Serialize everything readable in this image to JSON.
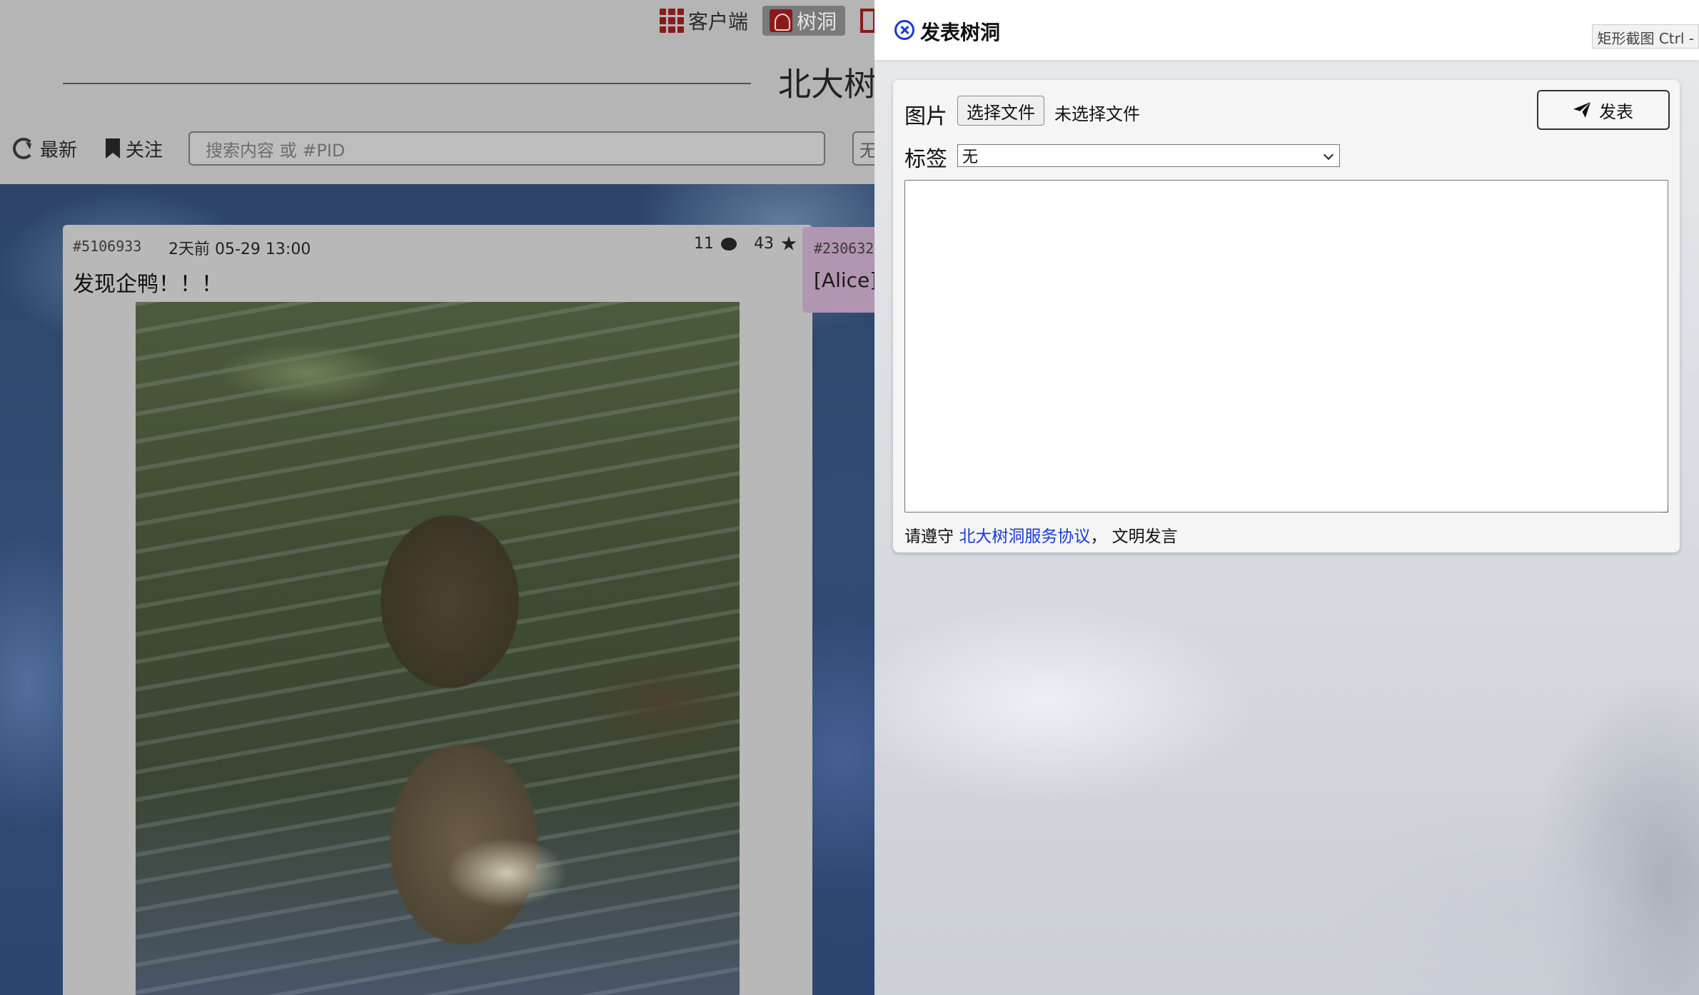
{
  "nav": {
    "client_label": "客户端",
    "treehole_label": "树洞",
    "site_title": "北大树洞"
  },
  "toolbar": {
    "refresh_label": "最新",
    "attention_label": "关注",
    "search_placeholder": "搜索内容 或 #PID",
    "search_mode_label": "无"
  },
  "posts": [
    {
      "pid": "#5106933",
      "time": "2天前  05-29 13:00",
      "reply_count": "11",
      "like_count": "43",
      "text": "发现企鸭！！！"
    },
    {
      "pid": "#230632",
      "text": "[Alice]"
    }
  ],
  "sidebar": {
    "title": "发表树洞",
    "snip_hint": "矩形截图 Ctrl -"
  },
  "compose": {
    "image_label": "图片",
    "file_button_label": "选择文件",
    "file_status": "未选择文件",
    "submit_label": "发表",
    "tag_label": "标签",
    "tag_selected": "无",
    "content_value": "",
    "rules_prefix": "请遵守",
    "rules_link": "北大树洞服务协议",
    "rules_suffix": "， 文明发言"
  },
  "icons": {
    "client": "qr-code-icon",
    "treehole": "treehole-logo-icon",
    "refresh": "refresh-icon",
    "attention": "bookmark-icon",
    "reply": "comment-icon",
    "like": "star-icon",
    "close": "close-circle-icon",
    "submit": "send-icon"
  }
}
